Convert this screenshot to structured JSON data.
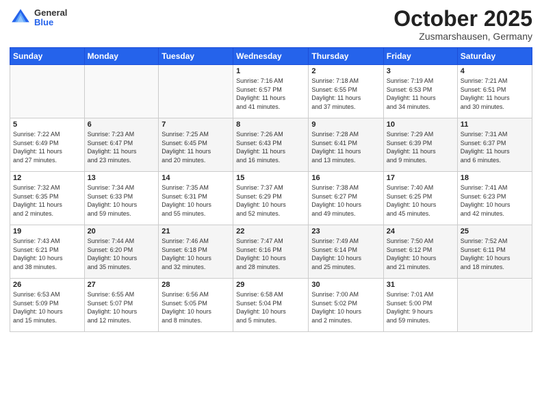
{
  "logo": {
    "general": "General",
    "blue": "Blue"
  },
  "title": "October 2025",
  "location": "Zusmarshausen, Germany",
  "headers": [
    "Sunday",
    "Monday",
    "Tuesday",
    "Wednesday",
    "Thursday",
    "Friday",
    "Saturday"
  ],
  "weeks": [
    [
      {
        "num": "",
        "info": ""
      },
      {
        "num": "",
        "info": ""
      },
      {
        "num": "",
        "info": ""
      },
      {
        "num": "1",
        "info": "Sunrise: 7:16 AM\nSunset: 6:57 PM\nDaylight: 11 hours\nand 41 minutes."
      },
      {
        "num": "2",
        "info": "Sunrise: 7:18 AM\nSunset: 6:55 PM\nDaylight: 11 hours\nand 37 minutes."
      },
      {
        "num": "3",
        "info": "Sunrise: 7:19 AM\nSunset: 6:53 PM\nDaylight: 11 hours\nand 34 minutes."
      },
      {
        "num": "4",
        "info": "Sunrise: 7:21 AM\nSunset: 6:51 PM\nDaylight: 11 hours\nand 30 minutes."
      }
    ],
    [
      {
        "num": "5",
        "info": "Sunrise: 7:22 AM\nSunset: 6:49 PM\nDaylight: 11 hours\nand 27 minutes."
      },
      {
        "num": "6",
        "info": "Sunrise: 7:23 AM\nSunset: 6:47 PM\nDaylight: 11 hours\nand 23 minutes."
      },
      {
        "num": "7",
        "info": "Sunrise: 7:25 AM\nSunset: 6:45 PM\nDaylight: 11 hours\nand 20 minutes."
      },
      {
        "num": "8",
        "info": "Sunrise: 7:26 AM\nSunset: 6:43 PM\nDaylight: 11 hours\nand 16 minutes."
      },
      {
        "num": "9",
        "info": "Sunrise: 7:28 AM\nSunset: 6:41 PM\nDaylight: 11 hours\nand 13 minutes."
      },
      {
        "num": "10",
        "info": "Sunrise: 7:29 AM\nSunset: 6:39 PM\nDaylight: 11 hours\nand 9 minutes."
      },
      {
        "num": "11",
        "info": "Sunrise: 7:31 AM\nSunset: 6:37 PM\nDaylight: 11 hours\nand 6 minutes."
      }
    ],
    [
      {
        "num": "12",
        "info": "Sunrise: 7:32 AM\nSunset: 6:35 PM\nDaylight: 11 hours\nand 2 minutes."
      },
      {
        "num": "13",
        "info": "Sunrise: 7:34 AM\nSunset: 6:33 PM\nDaylight: 10 hours\nand 59 minutes."
      },
      {
        "num": "14",
        "info": "Sunrise: 7:35 AM\nSunset: 6:31 PM\nDaylight: 10 hours\nand 55 minutes."
      },
      {
        "num": "15",
        "info": "Sunrise: 7:37 AM\nSunset: 6:29 PM\nDaylight: 10 hours\nand 52 minutes."
      },
      {
        "num": "16",
        "info": "Sunrise: 7:38 AM\nSunset: 6:27 PM\nDaylight: 10 hours\nand 49 minutes."
      },
      {
        "num": "17",
        "info": "Sunrise: 7:40 AM\nSunset: 6:25 PM\nDaylight: 10 hours\nand 45 minutes."
      },
      {
        "num": "18",
        "info": "Sunrise: 7:41 AM\nSunset: 6:23 PM\nDaylight: 10 hours\nand 42 minutes."
      }
    ],
    [
      {
        "num": "19",
        "info": "Sunrise: 7:43 AM\nSunset: 6:21 PM\nDaylight: 10 hours\nand 38 minutes."
      },
      {
        "num": "20",
        "info": "Sunrise: 7:44 AM\nSunset: 6:20 PM\nDaylight: 10 hours\nand 35 minutes."
      },
      {
        "num": "21",
        "info": "Sunrise: 7:46 AM\nSunset: 6:18 PM\nDaylight: 10 hours\nand 32 minutes."
      },
      {
        "num": "22",
        "info": "Sunrise: 7:47 AM\nSunset: 6:16 PM\nDaylight: 10 hours\nand 28 minutes."
      },
      {
        "num": "23",
        "info": "Sunrise: 7:49 AM\nSunset: 6:14 PM\nDaylight: 10 hours\nand 25 minutes."
      },
      {
        "num": "24",
        "info": "Sunrise: 7:50 AM\nSunset: 6:12 PM\nDaylight: 10 hours\nand 21 minutes."
      },
      {
        "num": "25",
        "info": "Sunrise: 7:52 AM\nSunset: 6:11 PM\nDaylight: 10 hours\nand 18 minutes."
      }
    ],
    [
      {
        "num": "26",
        "info": "Sunrise: 6:53 AM\nSunset: 5:09 PM\nDaylight: 10 hours\nand 15 minutes."
      },
      {
        "num": "27",
        "info": "Sunrise: 6:55 AM\nSunset: 5:07 PM\nDaylight: 10 hours\nand 12 minutes."
      },
      {
        "num": "28",
        "info": "Sunrise: 6:56 AM\nSunset: 5:05 PM\nDaylight: 10 hours\nand 8 minutes."
      },
      {
        "num": "29",
        "info": "Sunrise: 6:58 AM\nSunset: 5:04 PM\nDaylight: 10 hours\nand 5 minutes."
      },
      {
        "num": "30",
        "info": "Sunrise: 7:00 AM\nSunset: 5:02 PM\nDaylight: 10 hours\nand 2 minutes."
      },
      {
        "num": "31",
        "info": "Sunrise: 7:01 AM\nSunset: 5:00 PM\nDaylight: 9 hours\nand 59 minutes."
      },
      {
        "num": "",
        "info": ""
      }
    ]
  ]
}
